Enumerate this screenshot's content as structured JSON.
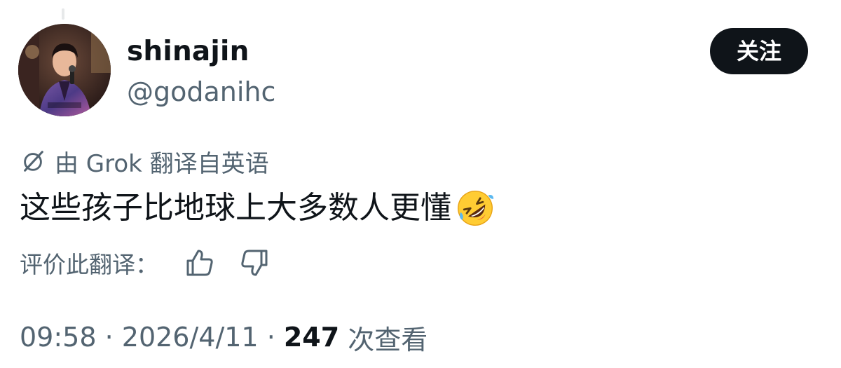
{
  "user": {
    "display_name": "shinajin",
    "handle": "@godanihc",
    "avatar_icon": "avatar-photo"
  },
  "follow_button": {
    "label": "关注"
  },
  "translation": {
    "icon": "grok-icon",
    "label": "由 Grok 翻译自英语"
  },
  "post": {
    "text": "这些孩子比地球上大多数人更懂",
    "emoji": "rolling-on-floor-laughing-emoji"
  },
  "rate": {
    "label": "评价此翻译：",
    "up_icon": "thumbs-up-icon",
    "down_icon": "thumbs-down-icon"
  },
  "meta": {
    "time": "09:58",
    "sep1": " · ",
    "date": "2026/4/11",
    "sep2": " · ",
    "views": "247",
    "views_label": " 次查看"
  },
  "colors": {
    "text_primary": "#0f1419",
    "text_secondary": "#536471",
    "button_bg": "#0f1419",
    "button_text": "#ffffff"
  }
}
